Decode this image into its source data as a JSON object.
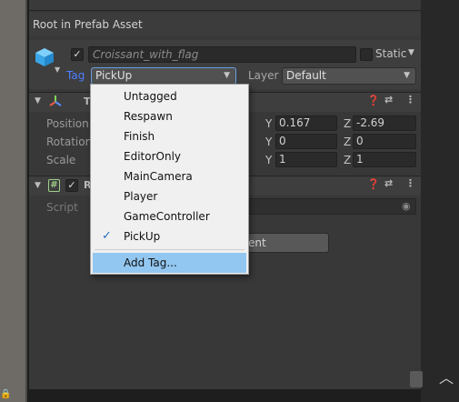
{
  "header": {
    "title": "Root in Prefab Asset"
  },
  "object": {
    "name": "Croissant_with_flag",
    "active_check": "✓",
    "static_label": "Static",
    "tag_label": "Tag",
    "tag_value": "PickUp",
    "layer_label": "Layer",
    "layer_value": "Default"
  },
  "transform": {
    "title_initial": "T",
    "rows": [
      {
        "label": "Position",
        "y": "0.167",
        "z": "-2.69"
      },
      {
        "label": "Rotation",
        "y": "0",
        "z": "0"
      },
      {
        "label": "Scale",
        "y": "1",
        "z": "1"
      }
    ],
    "axis_y": "Y",
    "axis_z": "Z"
  },
  "script_component": {
    "title_initial": "R",
    "enabled_check": "✓",
    "script_label": "Script"
  },
  "add_component": {
    "label_partial": "ent"
  },
  "tag_menu": {
    "items": [
      "Untagged",
      "Respawn",
      "Finish",
      "EditorOnly",
      "MainCamera",
      "Player",
      "GameController",
      "PickUp"
    ],
    "selected": "PickUp",
    "add_tag": "Add Tag...",
    "check_mark": "✓"
  },
  "colors": {
    "accent": "#4c7fff",
    "menu_highlight": "#92c7f1",
    "inspector_bg": "#383838"
  }
}
